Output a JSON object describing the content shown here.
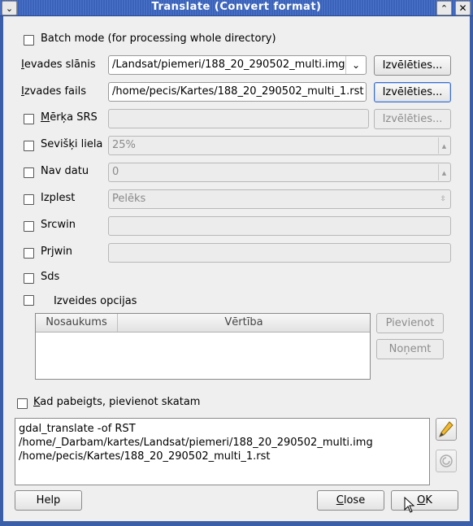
{
  "window": {
    "title": "Translate (Convert format)"
  },
  "batch_mode": {
    "label": "Batch mode (for processing whole directory)"
  },
  "input_layer": {
    "label": "Ievades slānis",
    "value": "/Landsat/piemeri/188_20_290502_multi.img",
    "browse_label": "Izvēlēties..."
  },
  "output_file": {
    "label": "Izvades fails",
    "value": "/home/pecis/Kartes/188_20_290502_multi_1.rst",
    "browse_label": "Izvēlēties..."
  },
  "target_srs": {
    "label": "Mērķa SRS",
    "value": "",
    "browse_label": "Izvēlēties..."
  },
  "resize": {
    "label": "Sevišķi liela",
    "value": "25%"
  },
  "no_data": {
    "label": "Nav datu",
    "value": "0"
  },
  "expand": {
    "label": "Izplest",
    "value": "Pelēks"
  },
  "srcwin": {
    "label": "Srcwin",
    "value": ""
  },
  "prjwin": {
    "label": "Prjwin",
    "value": ""
  },
  "sds": {
    "label": "Sds"
  },
  "creation_options": {
    "label": "Izveides opcijas",
    "columns": [
      "Nosaukums",
      "Vērtība"
    ],
    "add_label": "Pievienot",
    "remove_label": "Noņemt"
  },
  "load_when_finished": {
    "label": "Kad pabeigts, pievienot skatam"
  },
  "command": {
    "line1": "gdal_translate -of RST",
    "line2": "/home/_Darbam/kartes/Landsat/piemeri/188_20_290502_multi.img",
    "line3": "/home/pecis/Kartes/188_20_290502_multi_1.rst"
  },
  "buttons": {
    "help": "Help",
    "close": "Close",
    "ok": "OK"
  }
}
